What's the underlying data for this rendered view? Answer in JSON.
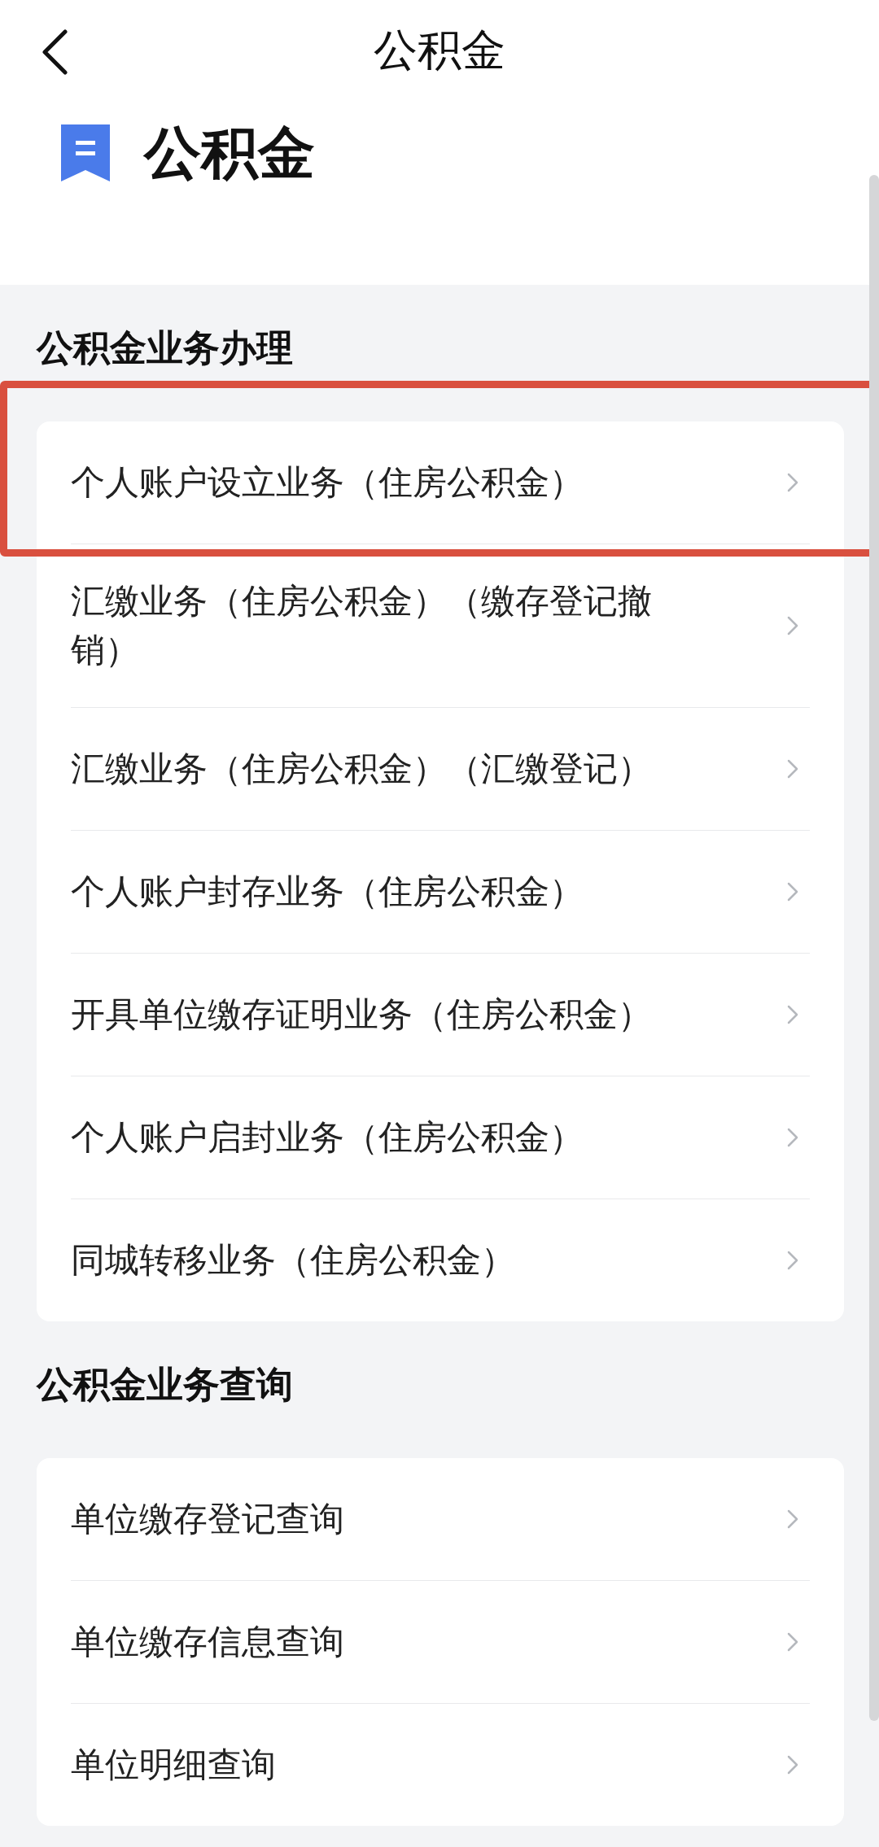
{
  "nav": {
    "title": "公积金"
  },
  "header": {
    "title": "公积金"
  },
  "sections": [
    {
      "title": "公积金业务办理",
      "items": [
        {
          "label": "个人账户设立业务（住房公积金）",
          "highlighted": true
        },
        {
          "label": "汇缴业务（住房公积金）（缴存登记撤销）",
          "highlighted": false
        },
        {
          "label": "汇缴业务（住房公积金）（汇缴登记）",
          "highlighted": false
        },
        {
          "label": "个人账户封存业务（住房公积金）",
          "highlighted": false
        },
        {
          "label": "开具单位缴存证明业务（住房公积金）",
          "highlighted": false
        },
        {
          "label": "个人账户启封业务（住房公积金）",
          "highlighted": false
        },
        {
          "label": "同城转移业务（住房公积金）",
          "highlighted": false
        }
      ]
    },
    {
      "title": "公积金业务查询",
      "items": [
        {
          "label": "单位缴存登记查询",
          "highlighted": false
        },
        {
          "label": "单位缴存信息查询",
          "highlighted": false
        },
        {
          "label": "单位明细查询",
          "highlighted": false
        }
      ]
    }
  ]
}
